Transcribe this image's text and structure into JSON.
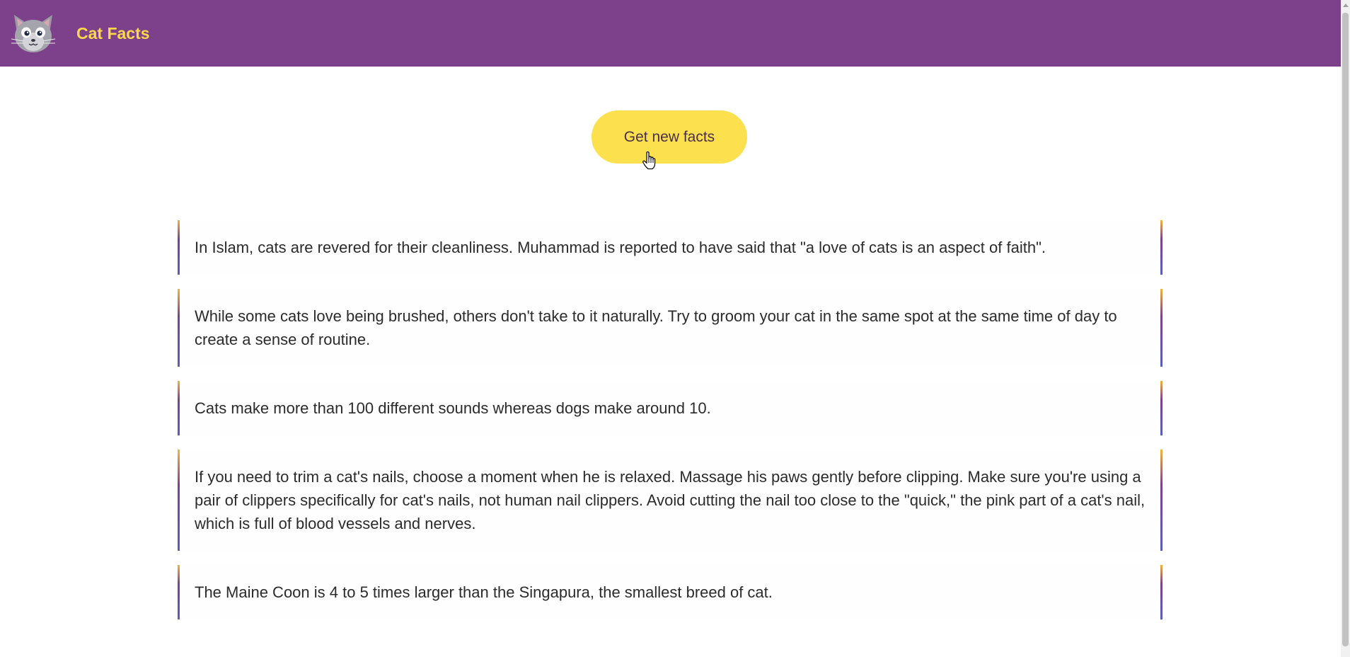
{
  "header": {
    "logo_icon": "cat-face-icon",
    "title": "Cat Facts",
    "background_color": "#7d418b",
    "title_color": "#fcd84c"
  },
  "main": {
    "button_label": "Get new facts",
    "button_color": "#fde04d",
    "facts": [
      "In Islam, cats are revered for their cleanliness. Muhammad is reported to have said that \"a love of cats is an aspect of faith\".",
      "While some cats love being brushed, others don't take to it naturally. Try to groom your cat in the same spot at the same time of day to create a sense of routine.",
      "Cats make more than 100 different sounds whereas dogs make around 10.",
      "If you need to trim a cat's nails, choose a moment when he is relaxed. Massage his paws gently before clipping. Make sure you're using a pair of clippers specifically for cat's nails, not human nail clippers. Avoid cutting the nail too close to the \"quick,\" the pink part of a cat's nail, which is full of blood vessels and nerves.",
      "The Maine Coon is 4 to 5 times larger than the Singapura, the smallest breed of cat."
    ]
  },
  "cursor_icon": "hand-pointer-icon"
}
